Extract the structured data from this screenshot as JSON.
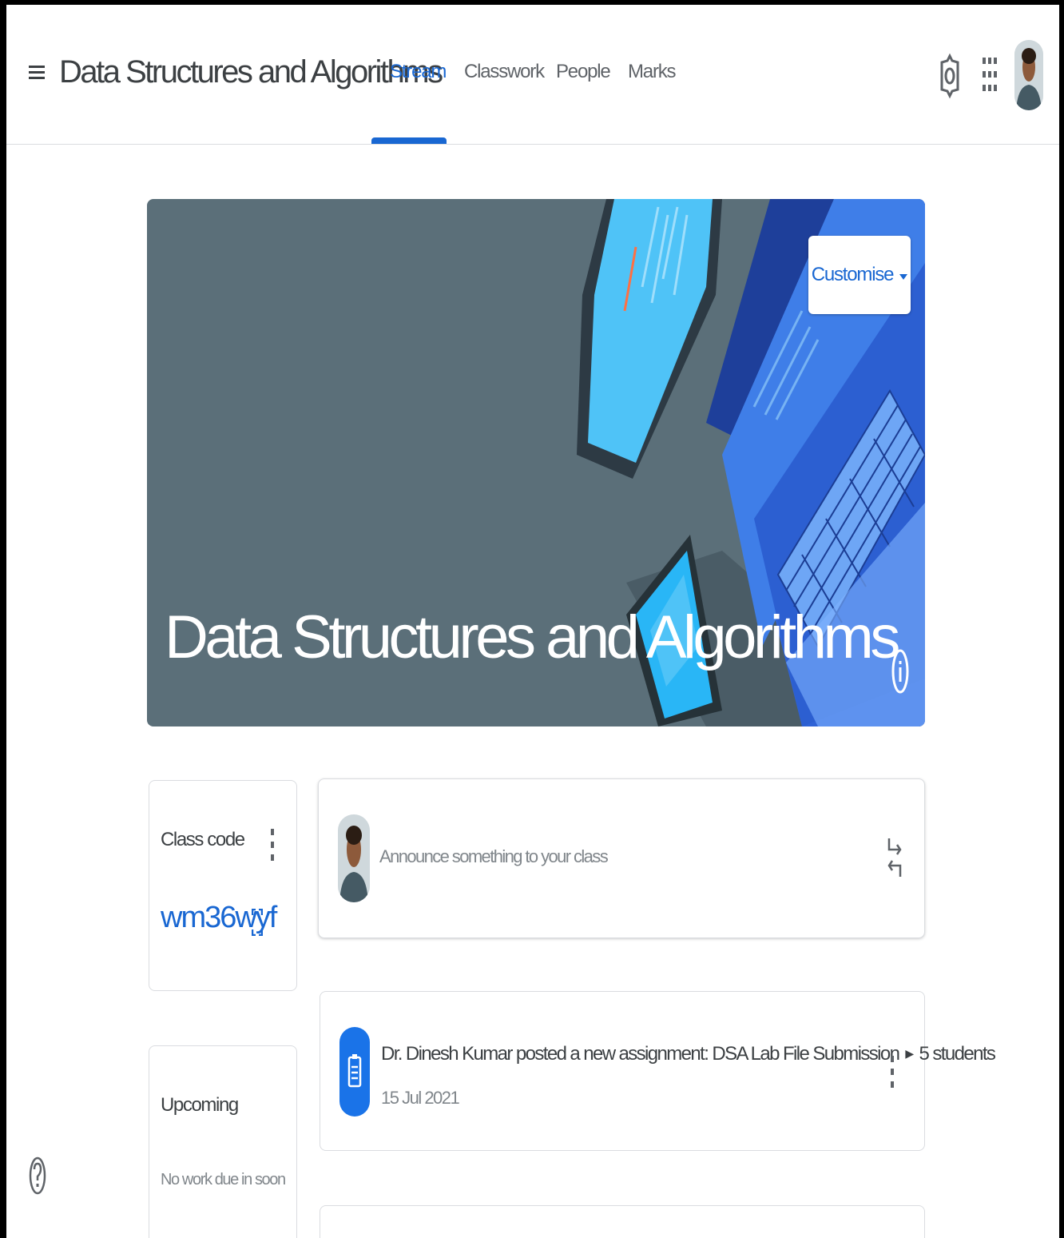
{
  "header": {
    "title": "Data Structures and Algorithms",
    "tabs": [
      {
        "label": "Stream",
        "active": true
      },
      {
        "label": "Classwork",
        "active": false
      },
      {
        "label": "People",
        "active": false
      },
      {
        "label": "Marks",
        "active": false
      }
    ],
    "icons": [
      "menu-icon",
      "settings-gear-icon",
      "apps-grid-icon",
      "account-avatar"
    ]
  },
  "banner": {
    "title": "Data Structures and Algorithms",
    "customise_label": "Customise",
    "colors": {
      "background": "#5b6f79",
      "accent": "#1967d2"
    }
  },
  "class_code": {
    "label": "Class code",
    "code": "wm36wyf"
  },
  "upcoming": {
    "label": "Upcoming",
    "empty_text": "No work due in soon"
  },
  "announce": {
    "placeholder": "Announce something to your class"
  },
  "posts": [
    {
      "text": "Dr. Dinesh Kumar posted a new assignment: DSA Lab File Submission",
      "audience": "5 students",
      "date": "15 Jul 2021",
      "icon": "assignment-icon"
    }
  ]
}
